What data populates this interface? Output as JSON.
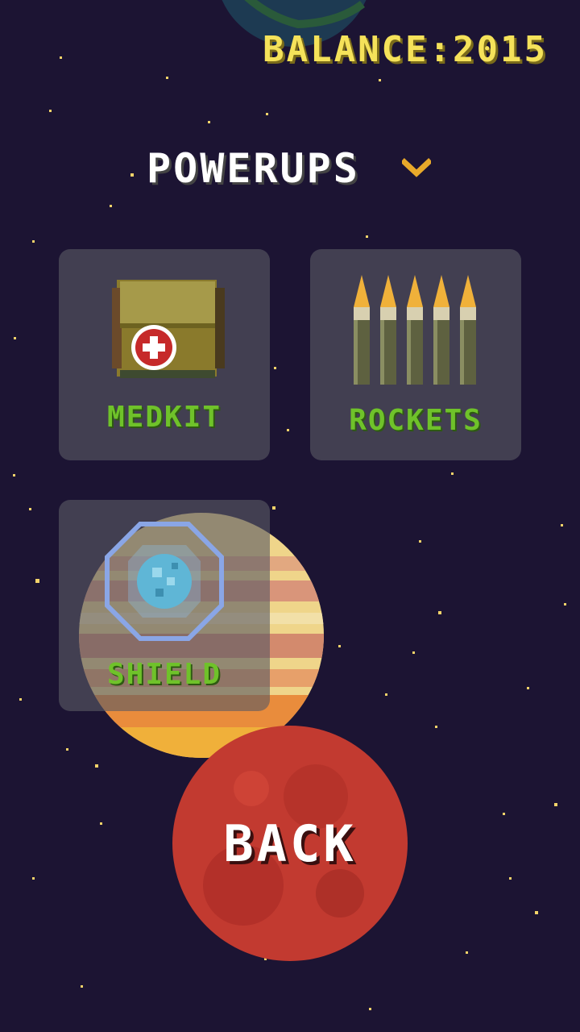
{
  "hud": {
    "balance_text": "BALANCE:2015"
  },
  "store": {
    "section_title": "POWERUPS",
    "dropdown_icon": "chevron-down-icon",
    "items": [
      {
        "label": "MEDKIT",
        "icon": "medkit-icon"
      },
      {
        "label": "ROCKETS",
        "icon": "rockets-icon"
      },
      {
        "label": "SHIELD",
        "icon": "shield-icon"
      }
    ]
  },
  "nav": {
    "back_label": "BACK"
  },
  "colors": {
    "background": "#1c1433",
    "balance_text": "#f5e25a",
    "item_label": "#6fc22a",
    "chevron": "#e8a92a",
    "card_bg": "#5a5a64"
  }
}
